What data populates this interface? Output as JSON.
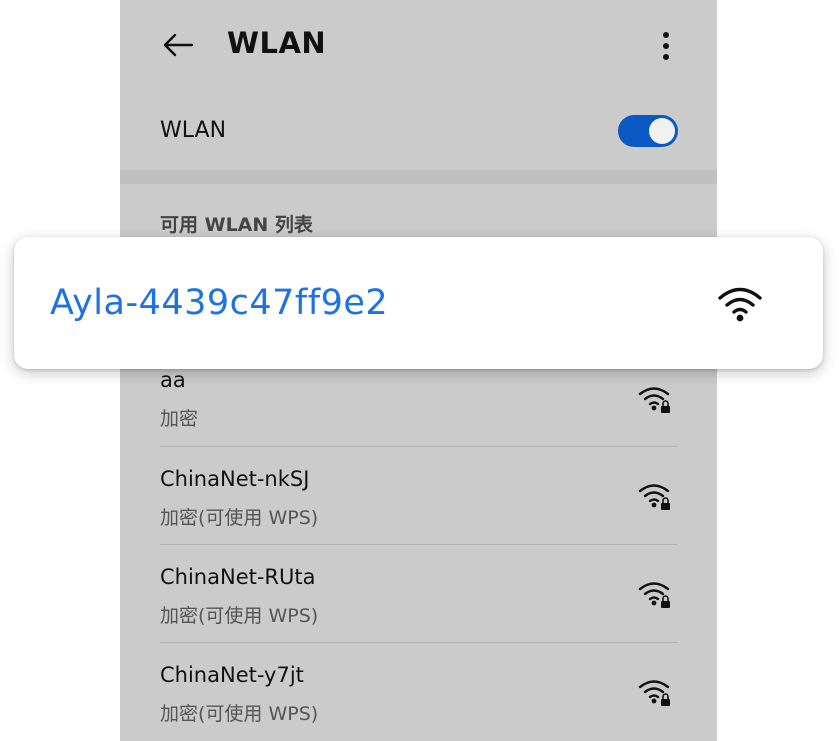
{
  "header": {
    "title": "WLAN"
  },
  "wlan_switch": {
    "label": "WLAN",
    "enabled": true,
    "accent": "#0a59c4"
  },
  "section": {
    "title": "可用 WLAN 列表"
  },
  "highlighted_network": {
    "name": "Ayla-4439c47ff9e2",
    "color": "#1e73de",
    "icon": "wifi-icon"
  },
  "networks": [
    {
      "name": "aa",
      "status": "加密",
      "icon": "wifi-lock-icon"
    },
    {
      "name": "ChinaNet-nkSJ",
      "status": "加密(可使用 WPS)",
      "icon": "wifi-lock-icon"
    },
    {
      "name": "ChinaNet-RUta",
      "status": "加密(可使用 WPS)",
      "icon": "wifi-lock-icon"
    },
    {
      "name": "ChinaNet-y7jt",
      "status": "加密(可使用 WPS)",
      "icon": "wifi-lock-icon"
    }
  ]
}
